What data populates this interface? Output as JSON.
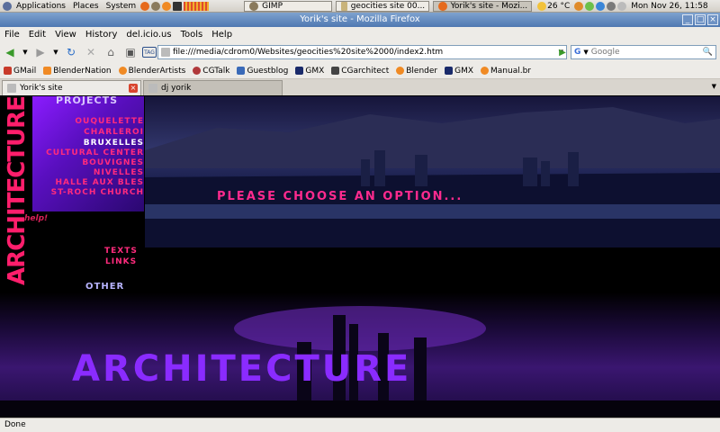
{
  "panel": {
    "menus": [
      "Applications",
      "Places",
      "System"
    ],
    "tasks": [
      {
        "label": "GIMP",
        "active": false
      },
      {
        "label": "geocities site 00...",
        "active": false
      },
      {
        "label": "Yorik's site - Mozi...",
        "active": true
      }
    ],
    "weather": "26 °C",
    "clock": "Mon Nov 26, 11:58"
  },
  "window": {
    "title": "Yorik's site - Mozilla Firefox"
  },
  "menubar": [
    "File",
    "Edit",
    "View",
    "History",
    "del.icio.us",
    "Tools",
    "Help"
  ],
  "navbar": {
    "url": "file:///media/cdrom0/Websites/geocities%20site%2000/index2.htm",
    "search_placeholder": "Google",
    "tag_label": "TAG"
  },
  "bookmarks": [
    "GMail",
    "BlenderNation",
    "BlenderArtists",
    "CGTalk",
    "Guestblog",
    "GMX",
    "CGarchitect",
    "Blender",
    "GMX",
    "Manual.br"
  ],
  "tabs": [
    {
      "label": "Yorik's site",
      "active": true
    },
    {
      "label": "dj yorik",
      "active": false
    }
  ],
  "page": {
    "side_word": "ARCHITECTURE",
    "projects_title": "PROJECTS",
    "projects": [
      {
        "label": "OUQUELETTE",
        "color": "pink"
      },
      {
        "label": "CHARLEROI",
        "color": "pink"
      },
      {
        "label": "BRUXELLES",
        "color": "white"
      },
      {
        "label": "CULTURAL CENTER",
        "color": "pink"
      },
      {
        "label": "BOUVIGNES",
        "color": "pink"
      },
      {
        "label": "NIVELLES",
        "color": "pink"
      },
      {
        "label": "HALLE AUX BLES",
        "color": "pink"
      },
      {
        "label": "ST-ROCH CHURCH",
        "color": "pink"
      }
    ],
    "texts_link": "TEXTS",
    "links_link": "LINKS",
    "other_label": "OTHER",
    "prompt": "PLEASE CHOOSE AN OPTION...",
    "big_word": "ARCHITECTURE",
    "help_link": "help!"
  },
  "status": "Done",
  "colors": {
    "accent_pink": "#ff2b7d",
    "accent_purple": "#8a2bff"
  }
}
